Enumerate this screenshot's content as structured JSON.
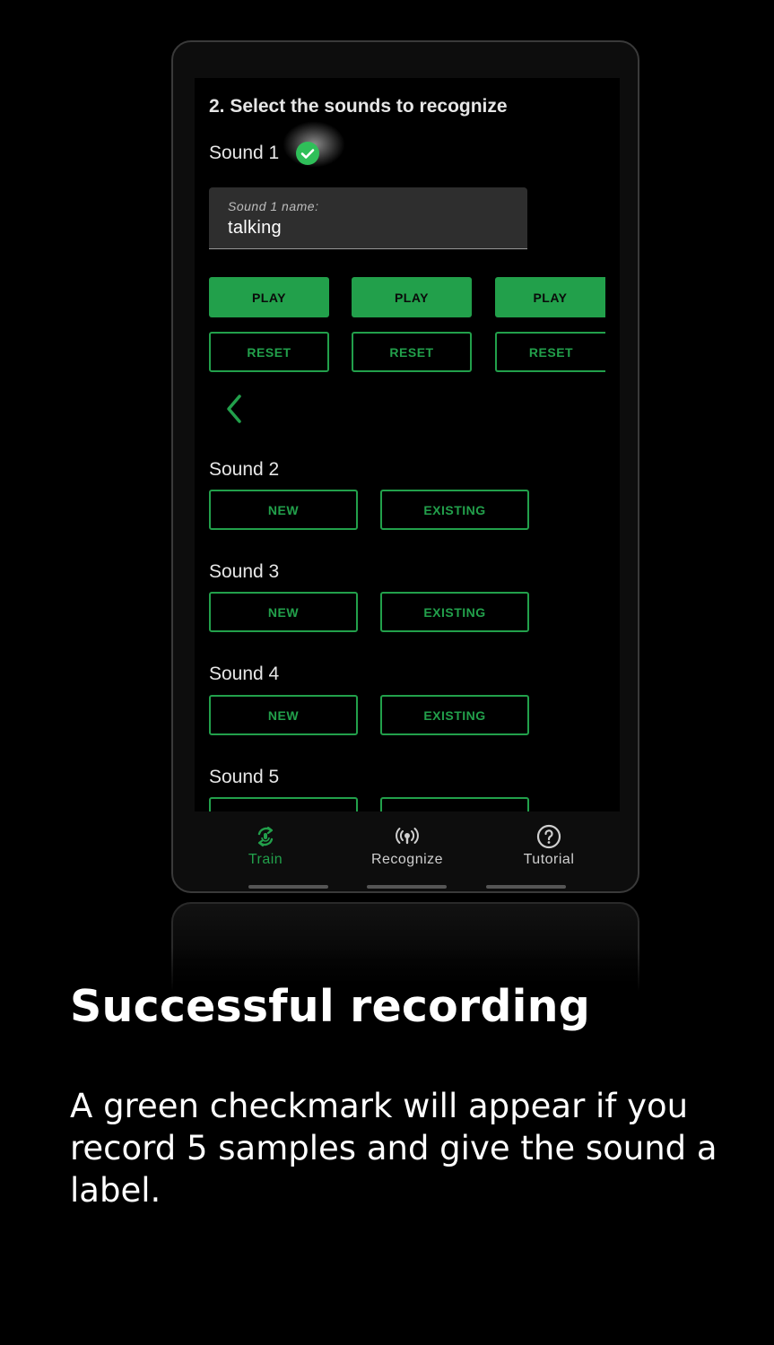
{
  "screen": {
    "section_title": "2. Select the sounds to recognize",
    "sound1": {
      "label": "Sound 1",
      "name_field_label": "Sound 1 name:",
      "name_field_value": "talking",
      "play_buttons": [
        "PLAY",
        "PLAY",
        "PLAY"
      ],
      "reset_buttons": [
        "RESET",
        "RESET",
        "RESET"
      ]
    },
    "sounds": [
      {
        "label": "Sound 2",
        "new": "NEW",
        "existing": "EXISTING"
      },
      {
        "label": "Sound 3",
        "new": "NEW",
        "existing": "EXISTING"
      },
      {
        "label": "Sound 4",
        "new": "NEW",
        "existing": "EXISTING"
      },
      {
        "label": "Sound 5",
        "new": "",
        "existing": ""
      }
    ]
  },
  "bottom_nav": [
    {
      "label": "Train",
      "icon": "train-icon",
      "active": true
    },
    {
      "label": "Recognize",
      "icon": "recognize-icon",
      "active": false
    },
    {
      "label": "Tutorial",
      "icon": "help-icon",
      "active": false
    }
  ],
  "caption": {
    "headline": "Successful recording",
    "body": "A green checkmark will appear if you record 5 samples and give the sound a label."
  },
  "colors": {
    "accent": "#22a04b",
    "check": "#2fbf59",
    "background": "#000000",
    "field": "#2e2e2e"
  }
}
